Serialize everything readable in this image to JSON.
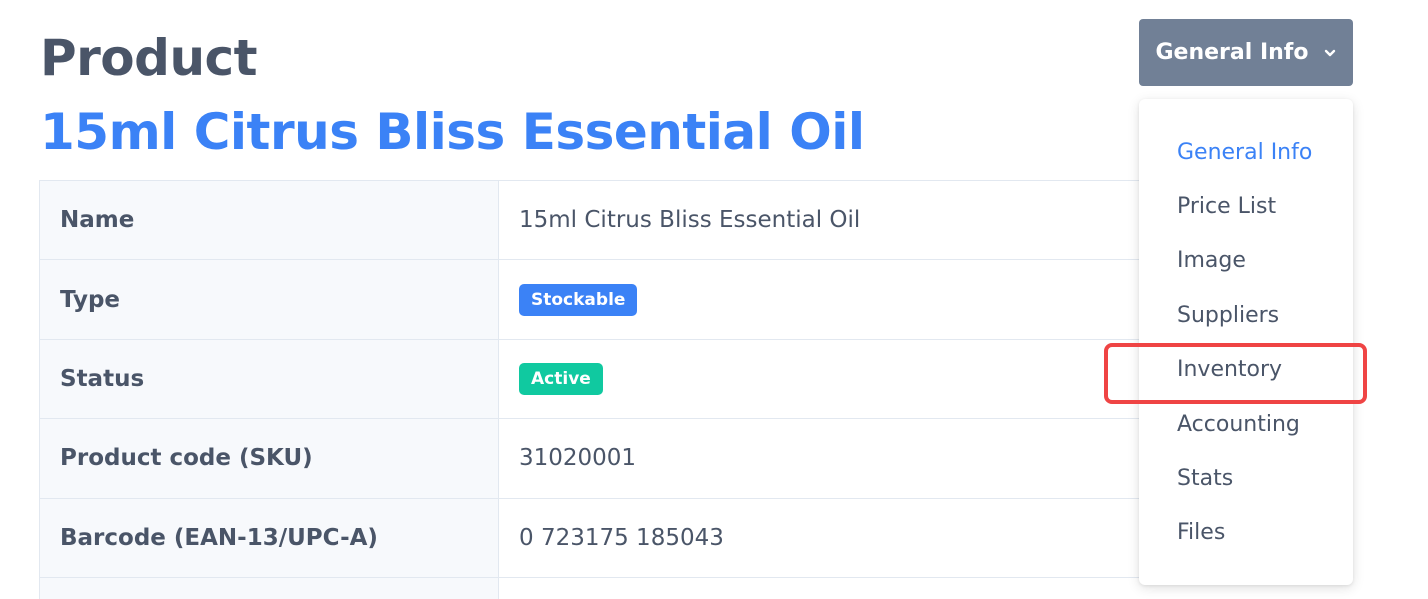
{
  "header": {
    "title": "Product",
    "product_name": "15ml Citrus Bliss Essential Oil"
  },
  "table": {
    "rows": [
      {
        "label": "Name",
        "value": "15ml Citrus Bliss Essential Oil"
      },
      {
        "label": "Type",
        "badge": "Stockable",
        "badge_color": "#3b82f6"
      },
      {
        "label": "Status",
        "badge": "Active",
        "badge_color": "#10c9a0"
      },
      {
        "label": "Product code (SKU)",
        "value": "31020001"
      },
      {
        "label": "Barcode (EAN-13/UPC-A)",
        "value": "0 723175 185043"
      }
    ]
  },
  "dropdown": {
    "button_label": "General Info",
    "button_icon": "chevron-down-icon",
    "items": [
      {
        "label": "General Info",
        "active": true
      },
      {
        "label": "Price List"
      },
      {
        "label": "Image"
      },
      {
        "label": "Suppliers"
      },
      {
        "label": "Inventory",
        "highlighted": true
      },
      {
        "label": "Accounting"
      },
      {
        "label": "Stats"
      },
      {
        "label": "Files"
      }
    ]
  },
  "colors": {
    "accent": "#3b82f6",
    "text": "#4a5568",
    "button_bg": "#718096",
    "highlight": "#ef4444",
    "active_badge": "#10c9a0"
  }
}
